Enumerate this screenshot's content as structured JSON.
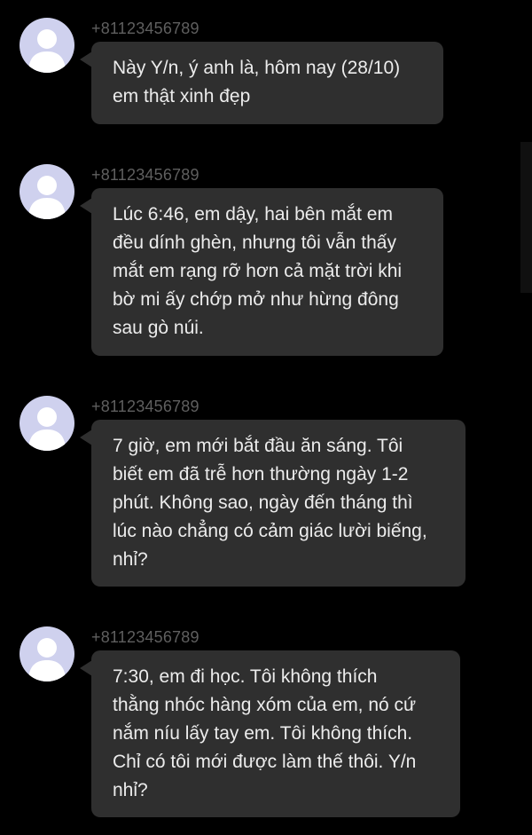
{
  "messages": [
    {
      "sender": "+81123456789",
      "lines": [
        "Này Y/n, ý anh là, hôm nay (28/10)",
        "em thật xinh đẹp"
      ]
    },
    {
      "sender": "+81123456789",
      "lines": [
        "Lúc 6:46, em dậy, hai bên mắt em",
        "đều dính ghèn, nhưng tôi vẫn thấy",
        "mắt em rạng rỡ hơn cả mặt trời khi",
        "bờ mi ấy chớp mở như hừng đông",
        "sau gò núi."
      ]
    },
    {
      "sender": "+81123456789",
      "lines": [
        "7 giờ, em mới bắt đầu ăn sáng. Tôi",
        "biết em đã trễ hơn thường ngày 1-2",
        "phút. Không sao, ngày đến tháng thì",
        "lúc nào chẳng có cảm giác lười biếng,",
        "nhỉ?"
      ]
    },
    {
      "sender": "+81123456789",
      "lines": [
        "7:30, em đi học. Tôi không thích",
        "thằng nhóc hàng xóm của em, nó cứ",
        "nắm níu lấy tay em. Tôi không thích.",
        "Chỉ có tôi mới được làm thế thôi. Y/n",
        "nhỉ?"
      ]
    }
  ],
  "colors": {
    "background": "#000000",
    "bubble": "#2f2f2f",
    "bubble_text": "#ececec",
    "sender_text": "#5f5f5f",
    "avatar_bg": "#cfd1ee",
    "avatar_silhouette": "#ffffff"
  },
  "icons": {
    "avatar": "default-user-avatar-icon"
  }
}
